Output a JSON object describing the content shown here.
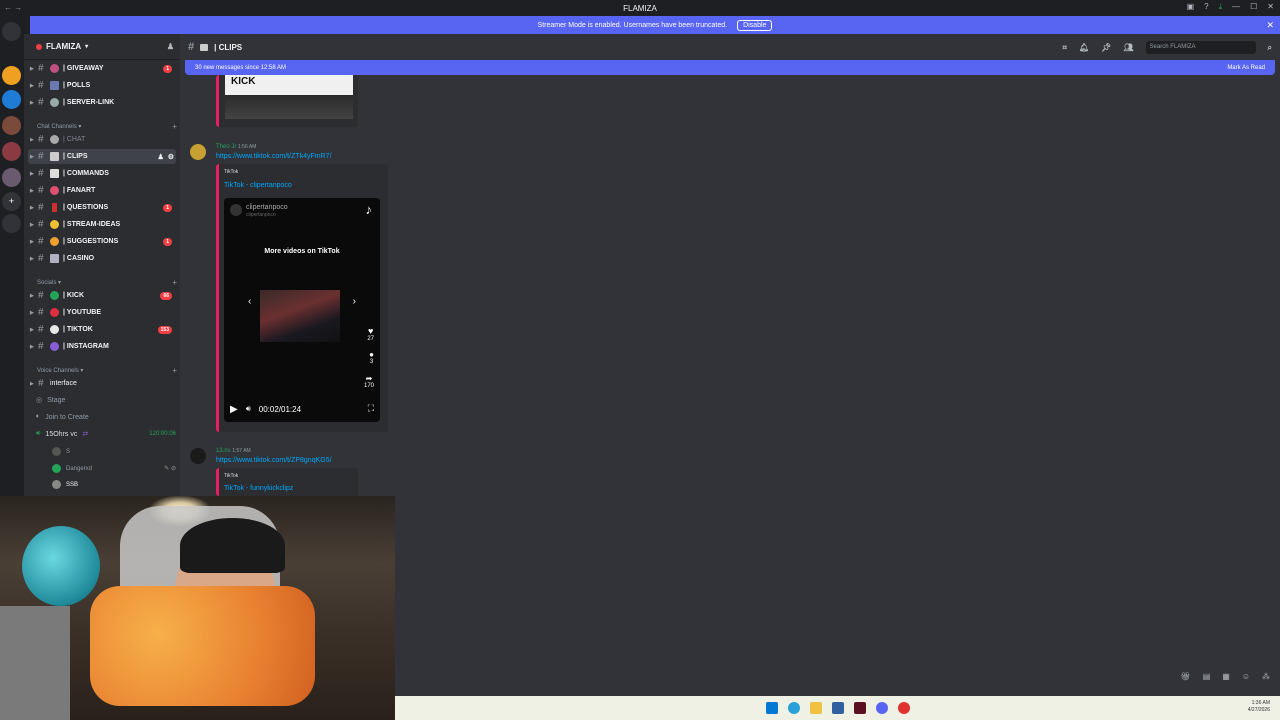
{
  "window": {
    "title": "FLAMIZA"
  },
  "banner": {
    "text": "Streamer Mode is enabled. Usernames have been truncated.",
    "button": "Disable"
  },
  "server": {
    "name": "FLAMIZA"
  },
  "channels": [
    {
      "name": "| GIVEAWAY",
      "count": "1"
    },
    {
      "name": "| POLLS",
      "count": ""
    },
    {
      "name": "| SERVER-LINK",
      "count": ""
    }
  ],
  "categories": {
    "chat": "Chat Channels",
    "socials": "Socials",
    "voice": "Voice Channels"
  },
  "chat_channels": [
    {
      "name": "| CHAT",
      "count": "",
      "muted": true
    },
    {
      "name": "| CLIPS",
      "count": "",
      "selected": true
    },
    {
      "name": "| COMMANDS",
      "count": ""
    },
    {
      "name": "| FANART",
      "count": ""
    },
    {
      "name": "| QUESTIONS",
      "count": "1"
    },
    {
      "name": "| STREAM-IDEAS",
      "count": ""
    },
    {
      "name": "| SUGGESTIONS",
      "count": "1"
    },
    {
      "name": "| CASINO",
      "count": ""
    }
  ],
  "social_channels": [
    {
      "name": "| KICK",
      "count": "66"
    },
    {
      "name": "| YOUTUBE",
      "count": ""
    },
    {
      "name": "| TIKTOK",
      "count": "153"
    },
    {
      "name": "| INSTAGRAM",
      "count": ""
    }
  ],
  "voice_channels": {
    "interface": "interface",
    "stage": "Stage",
    "join": "Join to Create",
    "vc": "15Ohrs vc",
    "vc_time": "120:00:06",
    "members": [
      "S",
      "Dangerxd",
      "SSB"
    ]
  },
  "chat": {
    "channel": "| CLIPS",
    "search_placeholder": "Search FLAMIZA",
    "new_messages": "30 new messages since 12:58 AM",
    "mark_read": "Mark As Read",
    "messages": [
      {
        "user": "Theo Jr",
        "time": "1:56 AM",
        "link": "https://www.tiktok.com/t/ZTk4yFmR7/",
        "provider": "TikTok",
        "title": "TikTok - clipertanpoco"
      },
      {
        "user": "13.ns",
        "time": "1:57 AM",
        "link": "https://www.tiktok.com/t/ZP8gnqKG5/",
        "provider": "TikTok",
        "title": "TikTok - funnykickclipz"
      }
    ],
    "video": {
      "account": "clipertanpoco",
      "account_sub": "clipertanpoco",
      "more": "More videos on TikTok",
      "time": "00:02/01:24",
      "likes": "27",
      "comments": "3",
      "shares": "170"
    }
  },
  "clock": {
    "time": "1:36 AM",
    "date": "4/27/2026"
  },
  "colors": {
    "accent": "#5865f2",
    "embed_border": "#e91e63",
    "badge": "#f23f43",
    "link": "#00a8fc"
  }
}
